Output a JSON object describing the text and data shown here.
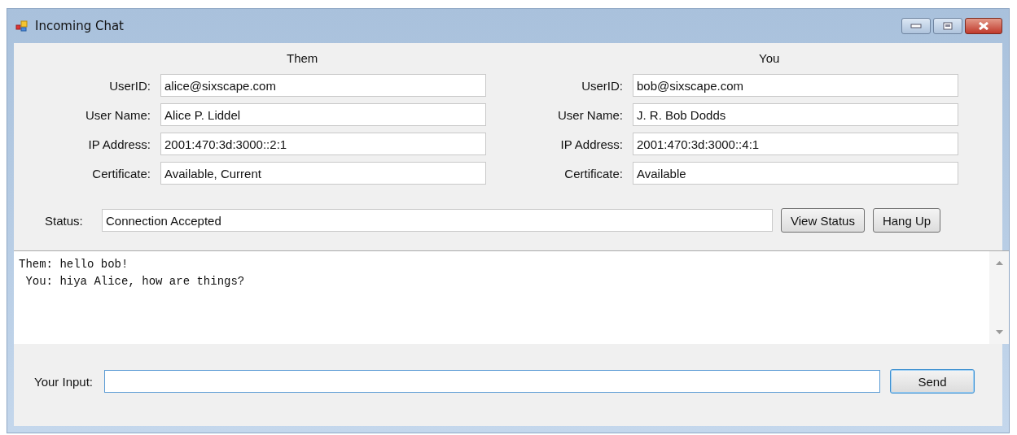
{
  "window": {
    "title": "Incoming Chat"
  },
  "parties": [
    {
      "heading": "Them",
      "fields": [
        {
          "label": "UserID:",
          "value": "alice@sixscape.com"
        },
        {
          "label": "User Name:",
          "value": "Alice P. Liddel"
        },
        {
          "label": "IP Address:",
          "value": "2001:470:3d:3000::2:1"
        },
        {
          "label": "Certificate:",
          "value": "Available, Current"
        }
      ]
    },
    {
      "heading": "You",
      "fields": [
        {
          "label": "UserID:",
          "value": "bob@sixscape.com"
        },
        {
          "label": "User Name:",
          "value": "J. R. Bob Dodds"
        },
        {
          "label": "IP Address:",
          "value": "2001:470:3d:3000::4:1"
        },
        {
          "label": "Certificate:",
          "value": "Available"
        }
      ]
    }
  ],
  "status": {
    "label": "Status:",
    "value": "Connection Accepted"
  },
  "status_buttons": [
    "View Status",
    "Hang Up"
  ],
  "chat_lines": [
    "Them: hello bob!",
    " You: hiya Alice, how are things?"
  ],
  "input": {
    "label": "Your Input:",
    "focused": true
  },
  "send_button": "Send"
}
